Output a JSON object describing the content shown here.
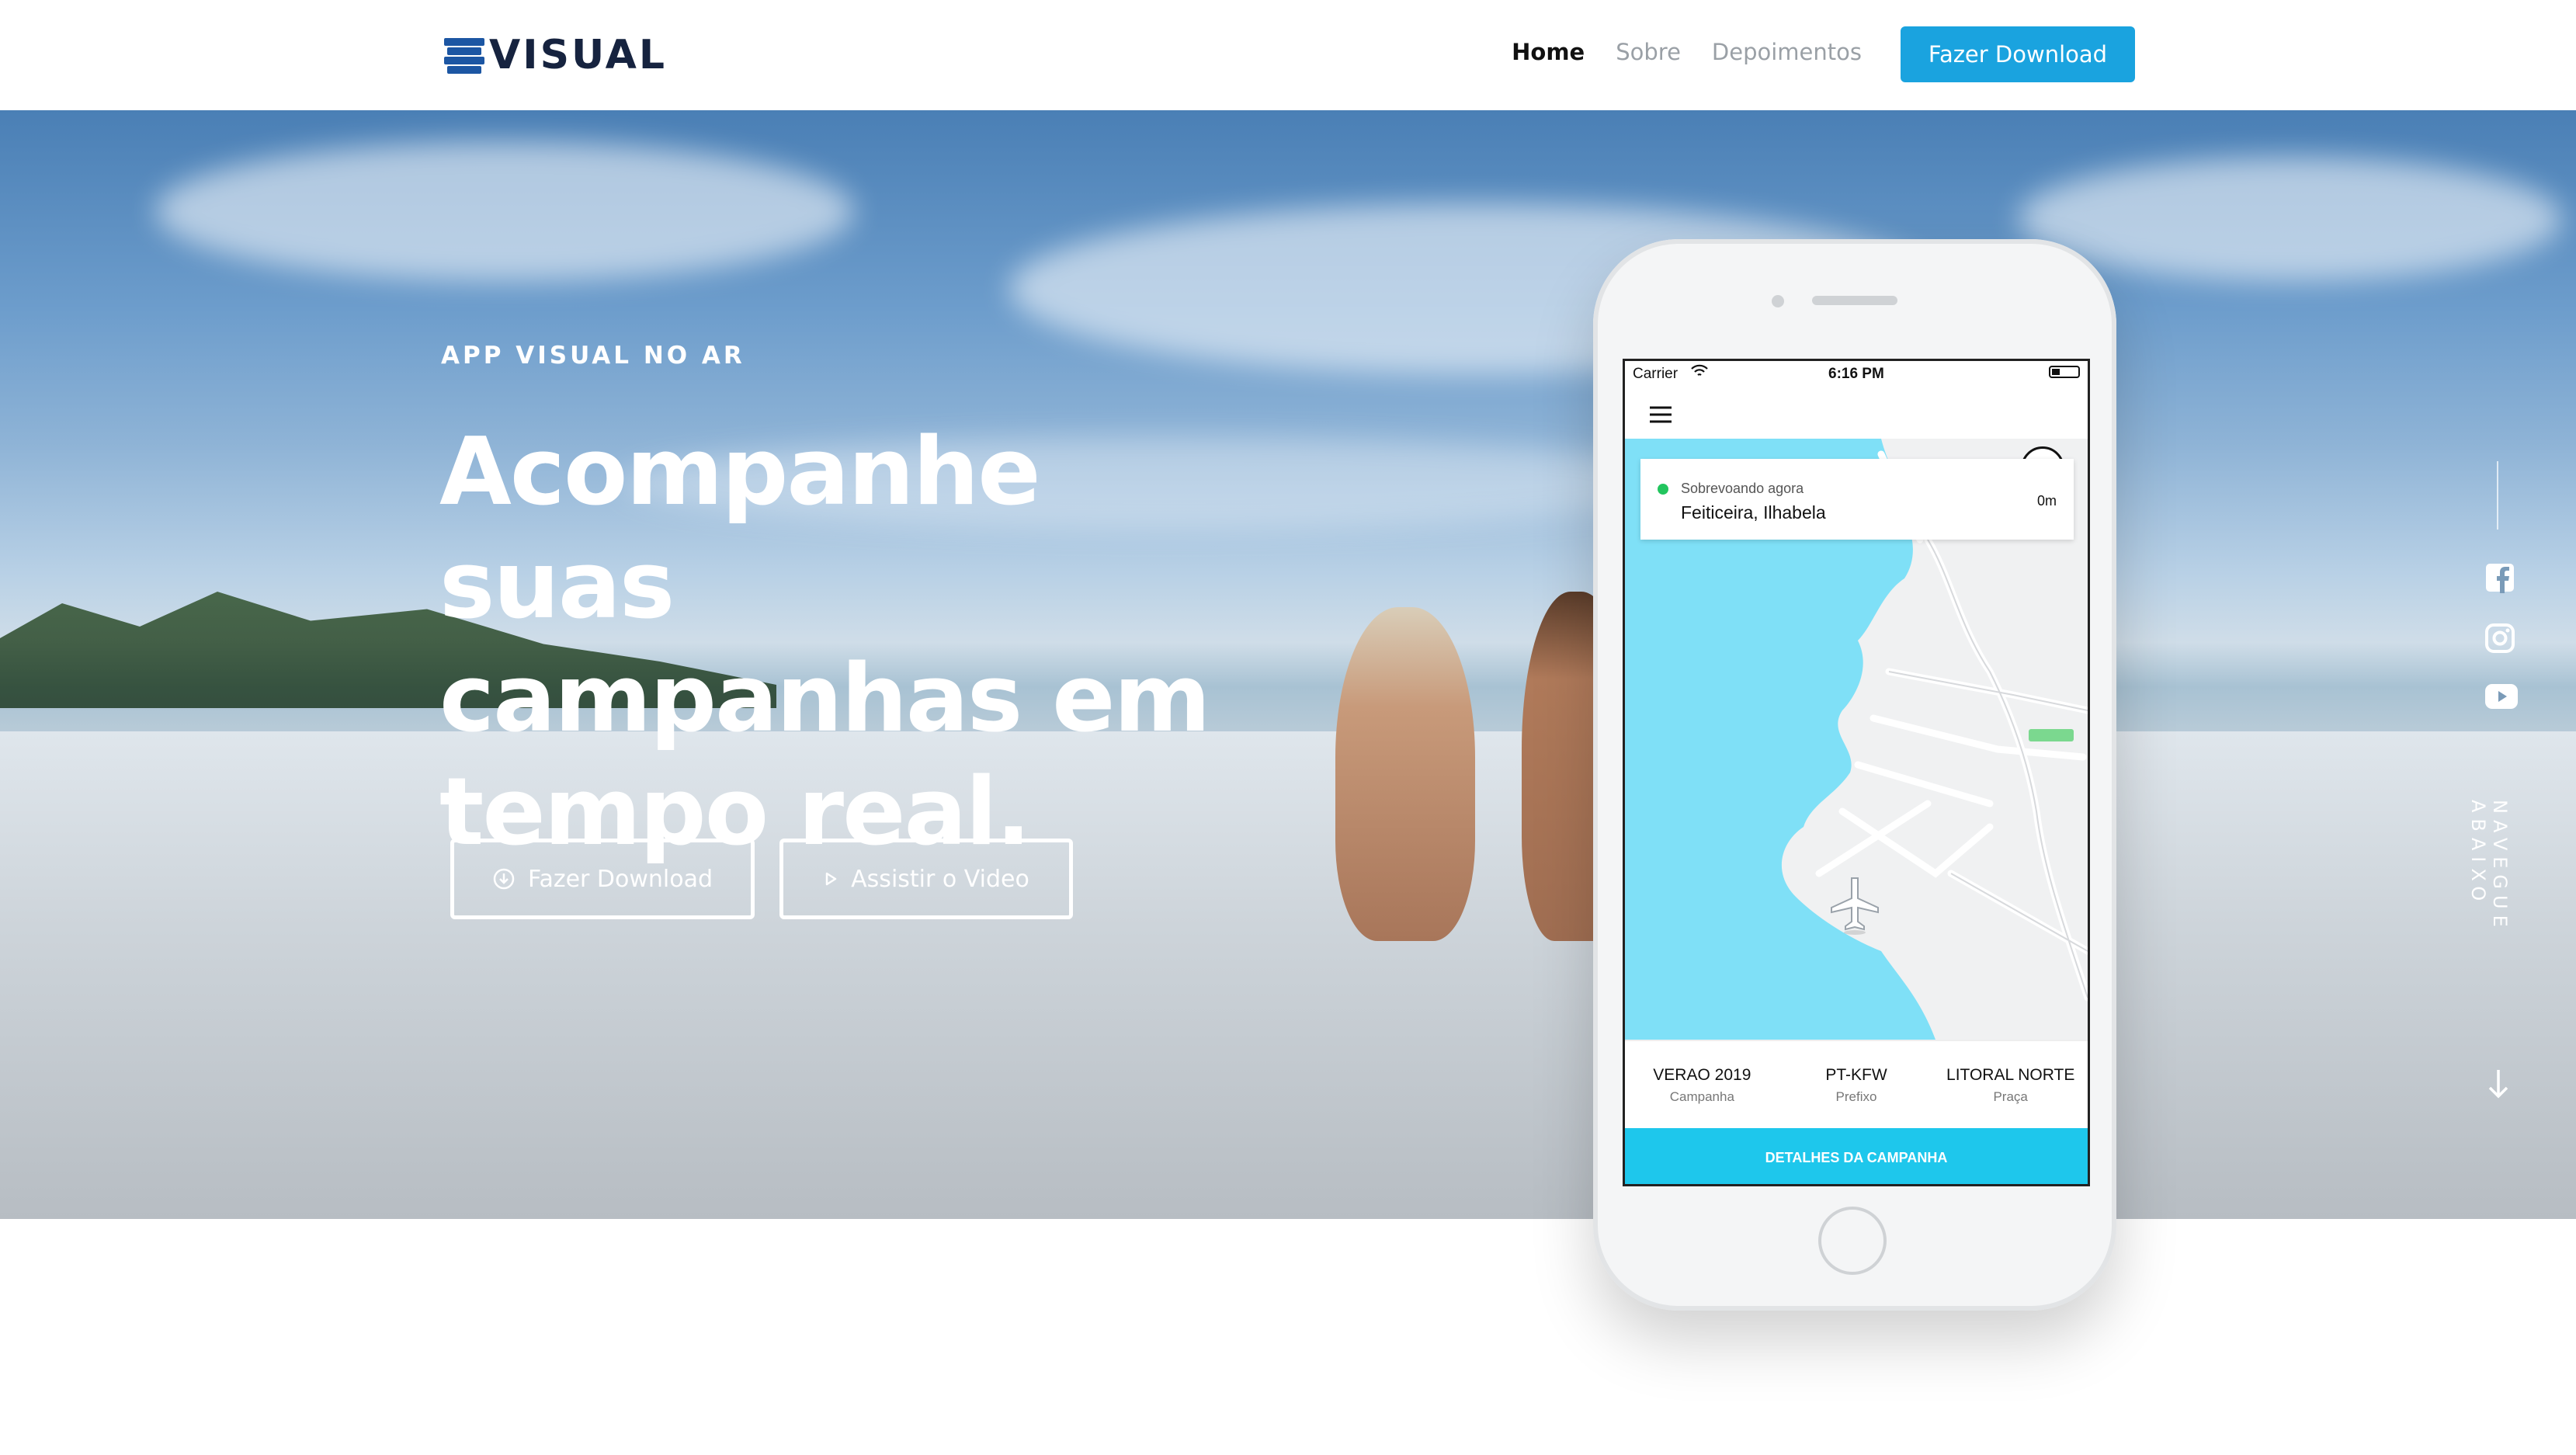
{
  "nav": {
    "logo_text": "VISUAL",
    "links": [
      {
        "label": "Home",
        "active": true
      },
      {
        "label": "Sobre",
        "active": false
      },
      {
        "label": "Depoimentos",
        "active": false
      }
    ],
    "cta_label": "Fazer Download"
  },
  "hero": {
    "kicker": "APP VISUAL NO AR",
    "title_line1": "Acompanhe suas",
    "title_line2": "campanhas em",
    "title_line3": "tempo real.",
    "download_label": "Fazer Download",
    "video_label": "Assistir o Video"
  },
  "side": {
    "scroll_hint": "NAVEGUE ABAIXO",
    "icons": [
      "facebook-icon",
      "instagram-icon",
      "youtube-icon",
      "arrow-down-icon"
    ]
  },
  "app": {
    "carrier": "Carrier",
    "time": "6:16 PM",
    "status_label": "Sobrevoando agora",
    "location": "Feiticeira, Ilhabela",
    "distance": "0m",
    "info": [
      {
        "value": "VERAO 2019",
        "label": "Campanha"
      },
      {
        "value": "PT-KFW",
        "label": "Prefixo"
      },
      {
        "value": "LITORAL NORTE",
        "label": "Praça"
      }
    ],
    "details_label": "DETALHES DA CAMPANHA"
  },
  "colors": {
    "accent": "#1aa3df",
    "map_water": "#7fe0f7",
    "live_dot": "#22c55e"
  }
}
